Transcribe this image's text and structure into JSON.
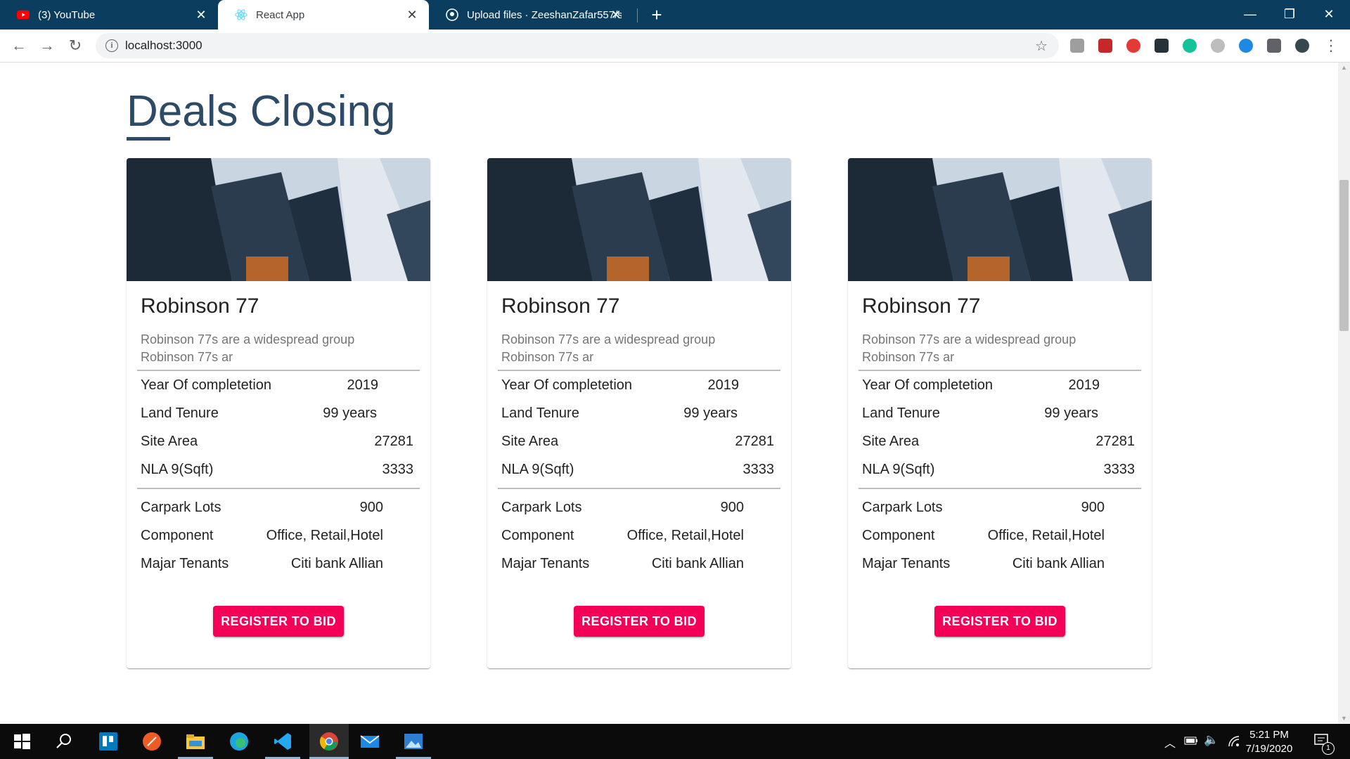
{
  "browser": {
    "tabs": [
      {
        "title": "(3) YouTube",
        "icon": "youtube-icon",
        "active": false
      },
      {
        "title": "React App",
        "icon": "react-icon",
        "active": true
      },
      {
        "title": "Upload files · ZeeshanZafar557/s",
        "icon": "github-icon",
        "active": false
      }
    ],
    "new_tab_label": "+",
    "url": "localhost:3000",
    "window_controls": {
      "minimize": "—",
      "restore": "❐",
      "close": "✕"
    }
  },
  "page": {
    "heading": "Deals Closing",
    "cards": [
      {
        "title": "Robinson 77",
        "description": "Robinson 77s are a widespread group Robinson 77s ar",
        "details_top": [
          {
            "label": "Year Of completetion",
            "value": "2019"
          },
          {
            "label": "Land Tenure",
            "value": "99 years"
          },
          {
            "label": "Site Area",
            "value": "27281"
          },
          {
            "label": "NLA 9(Sqft)",
            "value": "3333"
          }
        ],
        "details_bottom": [
          {
            "label": "Carpark Lots",
            "value": "900"
          },
          {
            "label": "Component",
            "value": "Office, Retail,Hotel"
          },
          {
            "label": "Majar Tenants",
            "value": "Citi bank Allian"
          }
        ],
        "button": "REGISTER TO BID"
      },
      {
        "title": "Robinson 77",
        "description": "Robinson 77s are a widespread group Robinson 77s ar",
        "details_top": [
          {
            "label": "Year Of completetion",
            "value": "2019"
          },
          {
            "label": "Land Tenure",
            "value": "99 years"
          },
          {
            "label": "Site Area",
            "value": "27281"
          },
          {
            "label": "NLA 9(Sqft)",
            "value": "3333"
          }
        ],
        "details_bottom": [
          {
            "label": "Carpark Lots",
            "value": "900"
          },
          {
            "label": "Component",
            "value": "Office, Retail,Hotel"
          },
          {
            "label": "Majar Tenants",
            "value": "Citi bank Allian"
          }
        ],
        "button": "REGISTER TO BID"
      },
      {
        "title": "Robinson 77",
        "description": "Robinson 77s are a widespread group Robinson 77s ar",
        "details_top": [
          {
            "label": "Year Of completetion",
            "value": "2019"
          },
          {
            "label": "Land Tenure",
            "value": "99 years"
          },
          {
            "label": "Site Area",
            "value": "27281"
          },
          {
            "label": "NLA 9(Sqft)",
            "value": "3333"
          }
        ],
        "details_bottom": [
          {
            "label": "Carpark Lots",
            "value": "900"
          },
          {
            "label": "Component",
            "value": "Office, Retail,Hotel"
          },
          {
            "label": "Majar Tenants",
            "value": "Citi bank Allian"
          }
        ],
        "button": "REGISTER TO BID"
      }
    ]
  },
  "taskbar": {
    "time": "5:21 PM",
    "date": "7/19/2020",
    "notification_count": "1"
  },
  "colors": {
    "tabstrip": "#0b3d5e",
    "heading": "#2d4a66",
    "button": "#f50057"
  }
}
